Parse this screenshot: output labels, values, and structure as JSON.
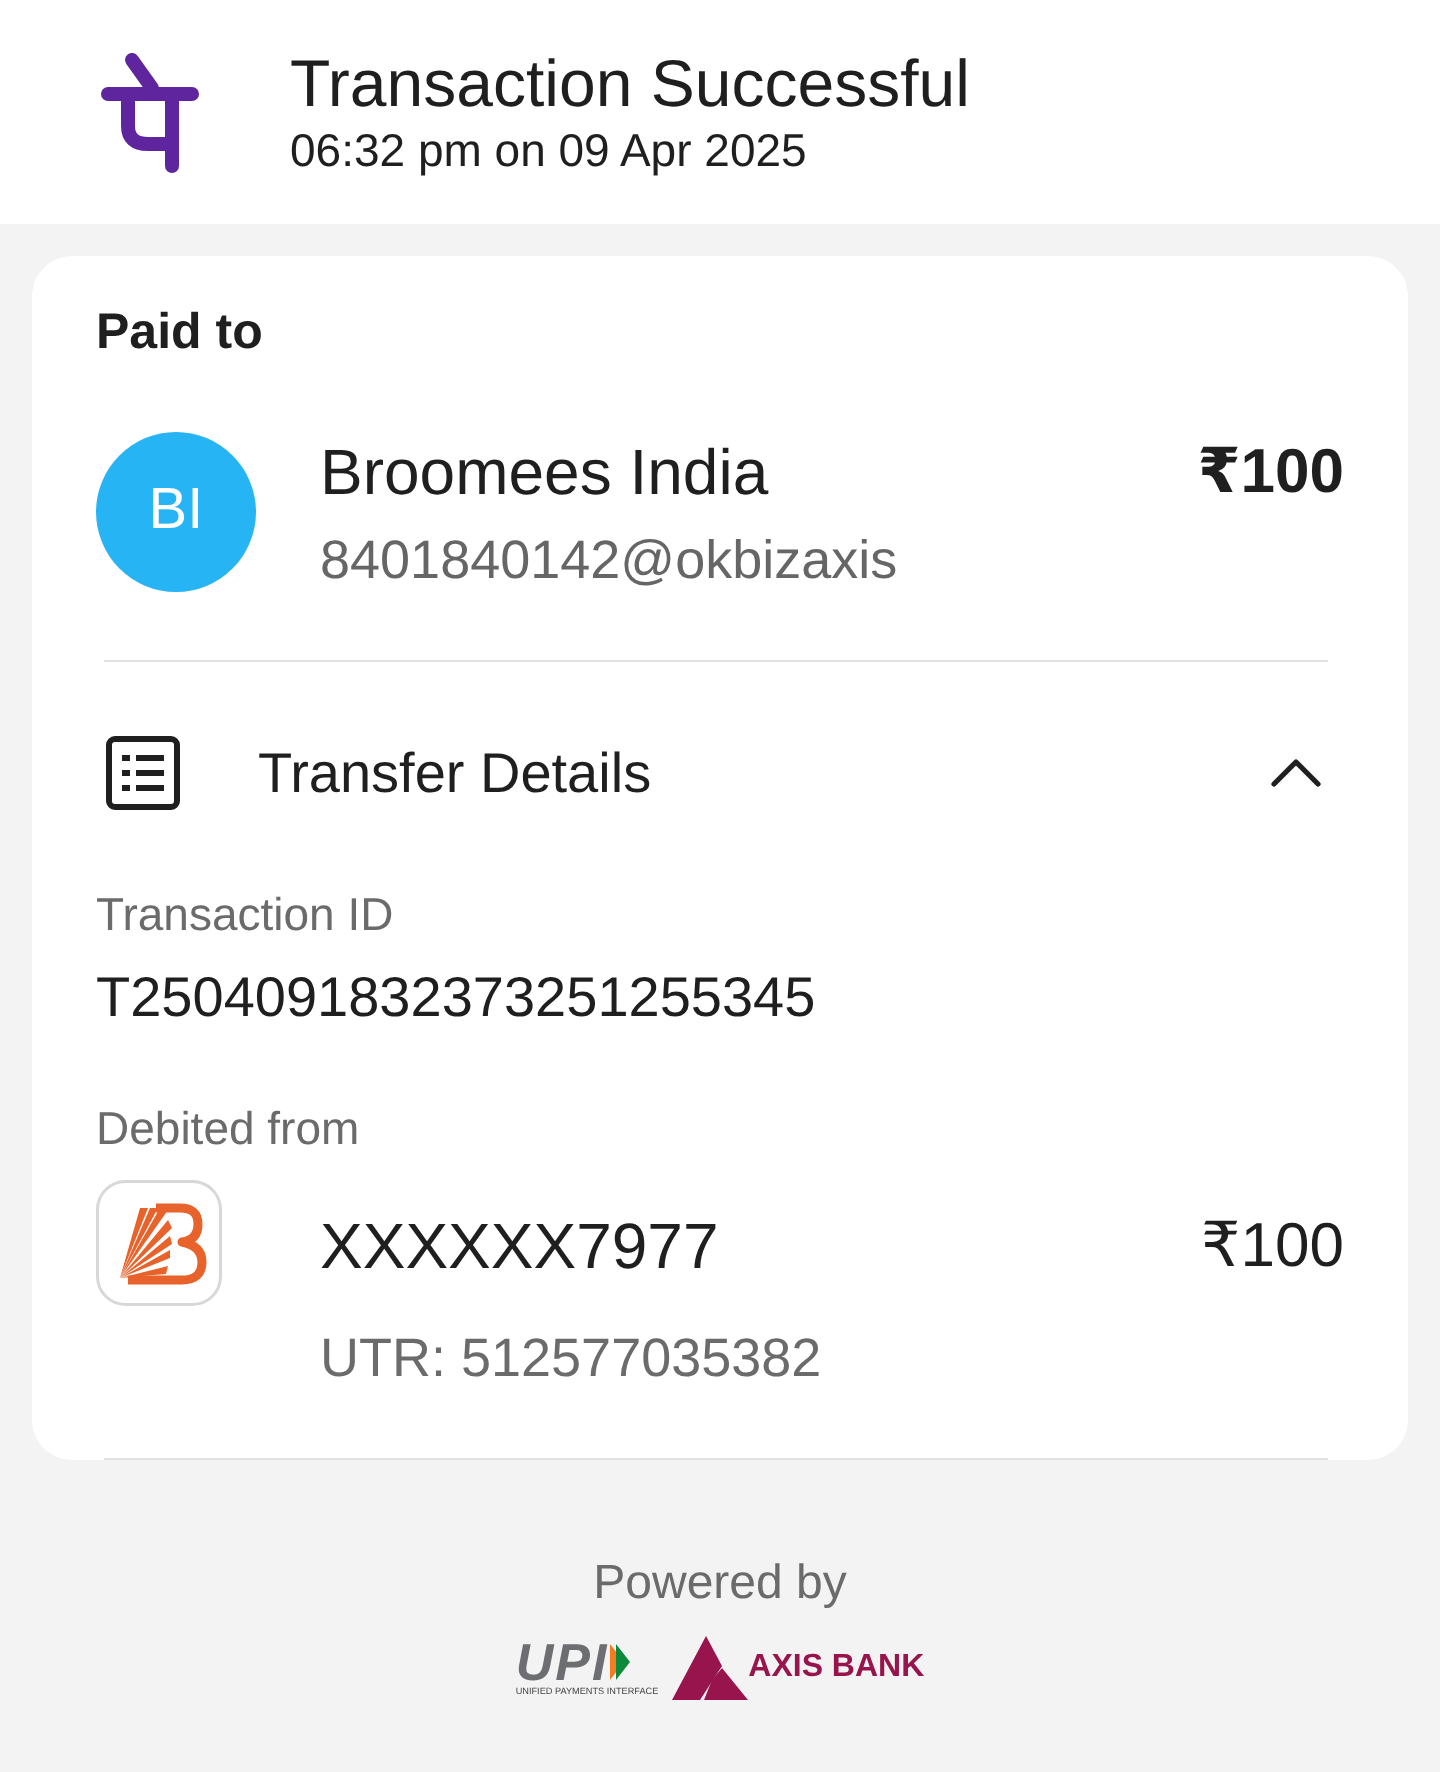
{
  "header": {
    "title": "Transaction Successful",
    "timestamp": "06:32 pm on 09 Apr 2025"
  },
  "paid_to": {
    "heading": "Paid to",
    "initials": "BI",
    "name": "Broomees India",
    "vpa": "8401840142@okbizaxis",
    "amount": "₹100"
  },
  "transfer_details": {
    "title": "Transfer Details",
    "expanded": true,
    "transaction_id_label": "Transaction ID",
    "transaction_id": "T2504091832373251255345",
    "debited_from_label": "Debited from",
    "account": "XXXXXX7977",
    "amount": "₹100",
    "utr": "UTR: 512577035382"
  },
  "footer": {
    "powered_by": "Powered by",
    "upi_logo": {
      "text": "UPI",
      "tagline": "UNIFIED PAYMENTS INTERFACE"
    },
    "bank_logo": {
      "text": "AXIS BANK"
    }
  }
}
